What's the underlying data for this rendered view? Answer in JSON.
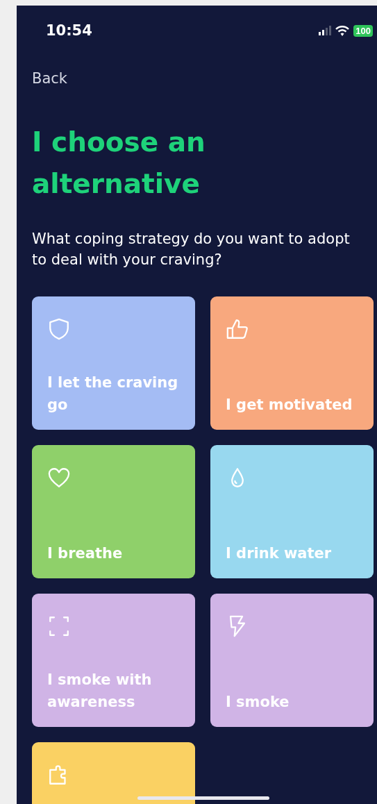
{
  "status_bar": {
    "time": "10:54",
    "battery": "100"
  },
  "back": {
    "label": "Back"
  },
  "title": "I choose an alternative",
  "prompt": "What coping strategy do you want to adopt to deal with your craving?",
  "options": [
    {
      "kind": "shield",
      "color": "#a4bcf4",
      "label": "I let the craving go"
    },
    {
      "kind": "thumbs-up",
      "color": "#f8a87e",
      "label": "I get motivated"
    },
    {
      "kind": "heart",
      "color": "#8fd06a",
      "label": "I breathe"
    },
    {
      "kind": "drop",
      "color": "#98d8ef",
      "label": "I drink water"
    },
    {
      "kind": "frame",
      "color": "#d0b4e6",
      "label": "I smoke with awareness"
    },
    {
      "kind": "bolt",
      "color": "#d0b4e6",
      "label": "I smoke"
    },
    {
      "kind": "puzzle",
      "color": "#fad163"
    }
  ]
}
